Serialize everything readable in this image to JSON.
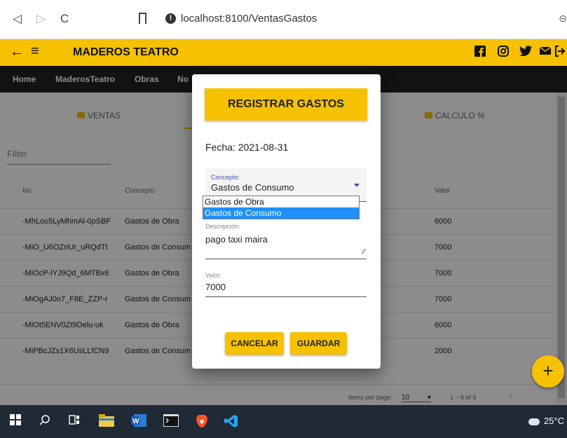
{
  "browser": {
    "url": "localhost:8100/VentasGastos",
    "back_icon": "◁",
    "forward_icon": "▷",
    "reload_icon": "C",
    "edge_icon": "⊝"
  },
  "toolbar": {
    "title": "MADEROS TEATRO",
    "back_icon": "←",
    "menu_icon": "≡",
    "social_icons": [
      "facebook-icon",
      "instagram-icon",
      "twitter-icon",
      "mail-icon",
      "logout-icon"
    ]
  },
  "nav": {
    "items": [
      "Home",
      "MaderosTeatro",
      "Obras",
      "No"
    ]
  },
  "tabs": {
    "ventas": "VENTAS",
    "calculo": "CALCULO %"
  },
  "filter": {
    "placeholder": "Filter"
  },
  "table": {
    "headers": [
      "No.",
      "Concepto",
      "Valor"
    ],
    "rows": [
      [
        "-MhLou5LyMhmAl-0pSBF",
        "Gastos de Obra",
        "6000"
      ],
      [
        "-MiO_U6OZriUr_uRQdTt",
        "Gastos de Consum",
        "7000"
      ],
      [
        "-MiOcP-lYJ9Qd_6MTBx6",
        "Gastos de Obra",
        "7000"
      ],
      [
        "-MiOgAJ0o7_F8E_ZZP-r",
        "Gastos de Consum",
        "7000"
      ],
      [
        "-MiOt5ENV0Zt9Delu-uk",
        "Gastos de Obra",
        "6000"
      ],
      [
        "-MiPBcJZs1X6UsLLfCN9",
        "Gastos de Consum",
        "2000"
      ]
    ]
  },
  "paginator": {
    "items_label": "Items per page:",
    "page_size": "10",
    "range": "1 – 6 of 6"
  },
  "fab": {
    "label": "+"
  },
  "modal": {
    "title": "REGISTRAR GASTOS",
    "fecha": "Fecha: 2021-08-31",
    "concepto_label": "Concepto:",
    "concepto_value": "Gastos de Consumo",
    "options": [
      "Gastos de Obra",
      "Gastos de Consumo"
    ],
    "descripcion_label": "Descripción:",
    "descripcion_value": "pago taxi maira",
    "valor_label": "Valor:",
    "valor_value": "7000",
    "cancel_label": "CANCELAR",
    "save_label": "GUARDAR"
  },
  "taskbar": {
    "temperature": "25°C"
  },
  "colors": {
    "accent": "#f5c100",
    "nav": "#222222",
    "selection": "#1e90ff"
  }
}
